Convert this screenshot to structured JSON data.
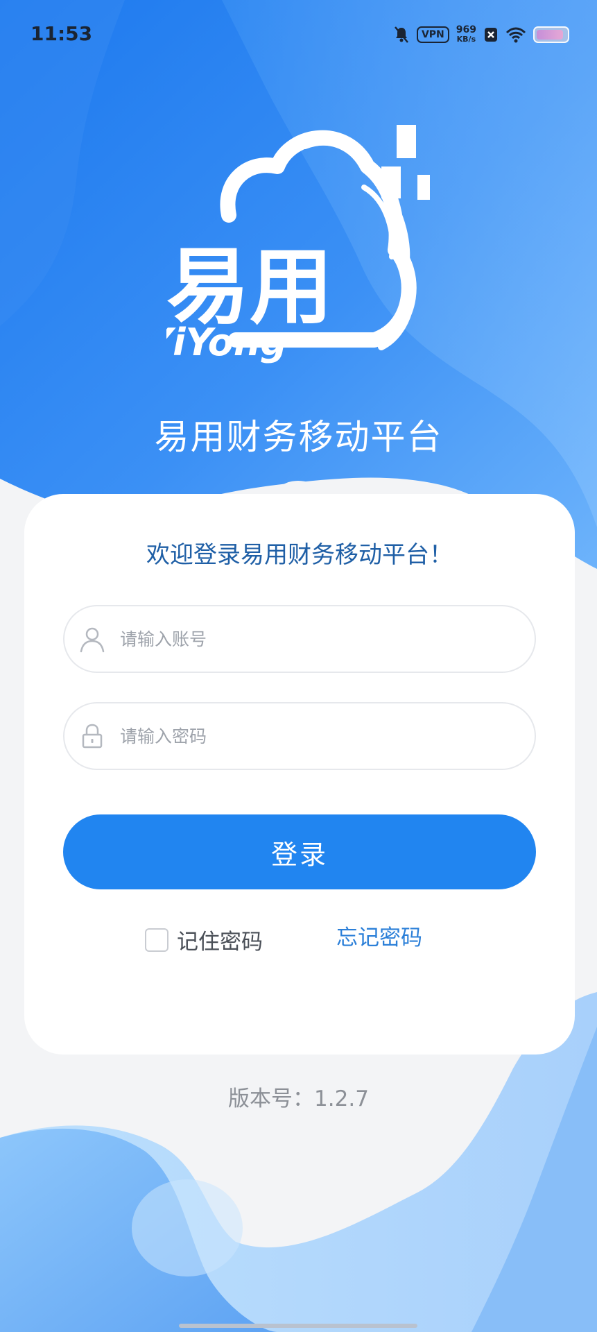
{
  "status_bar": {
    "time": "11:53",
    "vpn": "VPN",
    "net_speed_value": "969",
    "net_speed_unit": "KB/s",
    "icons": [
      "bell-muted-icon",
      "vpn-icon",
      "sim-icon",
      "wifi-icon",
      "battery-icon"
    ]
  },
  "header": {
    "logo_text": "易用",
    "logo_subtext": "YiYong",
    "title": "易用财务移动平台"
  },
  "login_card": {
    "welcome": "欢迎登录易用财务移动平台！",
    "account_placeholder": "请输入账号",
    "password_placeholder": "请输入密码",
    "login_label": "登录",
    "remember_label": "记住密码",
    "remember_checked": false,
    "forgot_label": "忘记密码"
  },
  "footer": {
    "version": "版本号：1.2.7"
  },
  "colors": {
    "primary": "#2185f0",
    "welcome_text": "#1f5fa6",
    "link": "#2b7fd8",
    "background": "#f3f4f6"
  }
}
